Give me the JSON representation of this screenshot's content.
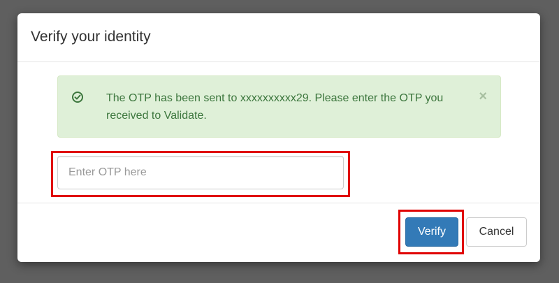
{
  "modal": {
    "title": "Verify your identity"
  },
  "alert": {
    "icon": "check-circle-icon",
    "message": "The OTP has been sent to xxxxxxxxxx29. Please enter the OTP you received to Validate.",
    "close_symbol": "×",
    "color": "#3c763d",
    "background": "#dff0d8"
  },
  "otp": {
    "placeholder": "Enter OTP here",
    "value": ""
  },
  "footer": {
    "verify_label": "Verify",
    "cancel_label": "Cancel"
  },
  "colors": {
    "primary": "#337ab7",
    "highlight": "#e00000",
    "backdrop": "#5f5f5f"
  }
}
